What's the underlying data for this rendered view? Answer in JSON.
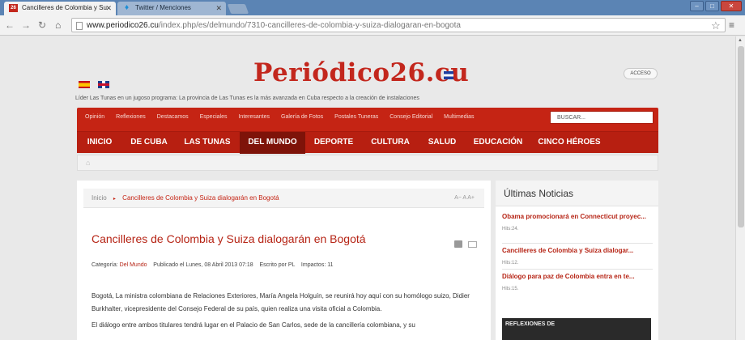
{
  "browser": {
    "tabs": [
      {
        "label": "Cancilleres de Colombia y Su",
        "favicon": "26"
      },
      {
        "label": "Twitter / Menciones",
        "favicon": "bird-icon"
      }
    ],
    "url_host": "www.periodico26.cu",
    "url_path": "/index.php/es/delmundo/7310-cancilleres-de-colombia-y-suiza-dialogaran-en-bogota"
  },
  "site": {
    "logo": "Periódico26.cu",
    "acceso": "ACCESO",
    "ticker": "Líder Las Tunas en un jugoso programa: La provincia de Las Tunas es la más avanzada en Cuba respecto a la creación de instalaciones",
    "subnav": [
      "Opinión",
      "Reflexiones",
      "Destacamos",
      "Especiales",
      "Interesantes",
      "Galería de Fotos",
      "Postales Tuneras",
      "Consejo Editorial",
      "Multimedias"
    ],
    "search_placeholder": "BUSCAR...",
    "mainnav": [
      "INICIO",
      "DE CUBA",
      "LAS TUNAS",
      "DEL MUNDO",
      "DEPORTE",
      "CULTURA",
      "SALUD",
      "EDUCACIÓN",
      "CINCO HÉROES"
    ]
  },
  "article": {
    "crumb_home": "Inicio",
    "crumb_current": "Cancilleres de Colombia y Suiza dialogarán en Bogotá",
    "font_controls": "A−  A  A+",
    "title": "Cancilleres de Colombia y Suiza dialogarán en Bogotá",
    "category_label": "Categoría:",
    "category": "Del Mundo",
    "published": "Publicado el Lunes, 08 Abril 2013 07:18",
    "author": "Escrito por PL",
    "impacts": "Impactos: 11",
    "p1": "Bogotá,  La ministra colombiana de Relaciones Exteriores, María Angela Holguín, se reunirá hoy aquí con su homólogo suizo, Didier Burkhalter, vicepresidente del Consejo Federal de su país, quien realiza una visita oficial a Colombia.",
    "p2": "El diálogo entre ambos titulares tendrá lugar en el Palacio de San Carlos, sede de la cancillería colombiana, y su"
  },
  "sidebar": {
    "title": "Últimas Noticias",
    "news": [
      {
        "title": "Obama promocionará en Connecticut proyec...",
        "hits": "Hits:24."
      },
      {
        "title": "Cancilleres de Colombia y Suiza dialogar...",
        "hits": "Hits:12."
      },
      {
        "title": "Diálogo para paz de Colombia entra en te...",
        "hits": "Hits:15."
      }
    ],
    "banner": "REFLEXIONES DE"
  }
}
